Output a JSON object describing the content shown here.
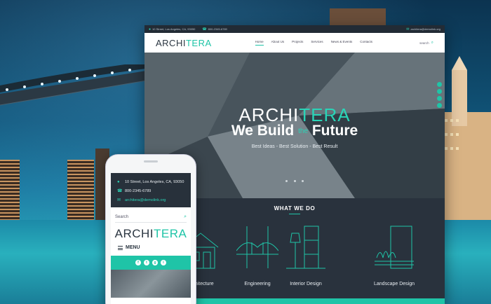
{
  "colors": {
    "accent": "#1fc4a7",
    "dark": "#29323d",
    "white": "#ffffff"
  },
  "desktop": {
    "topbar": {
      "address": "10 Street, Los Angeles, CA, 93050",
      "phone": "800-2345-6789",
      "email": "architera@demolink.org"
    },
    "logo": {
      "part1": "ARCHI",
      "part2": "TERA"
    },
    "menu": [
      "Home",
      "About Us",
      "Projects",
      "Services",
      "News & Events",
      "Contacts"
    ],
    "search_label": "search",
    "hero": {
      "logo_part1": "ARCHI",
      "logo_part2": "TERA",
      "title_before": "We Build",
      "title_the": "the",
      "title_after": "Future",
      "subtitle": "Best Ideas - Best Solution - Best Result"
    },
    "what_we_do": {
      "title": "WHAT WE DO",
      "services": [
        {
          "label": "Architecture",
          "icon": "house-icon"
        },
        {
          "label": "Engineering",
          "icon": "bridge-icon"
        },
        {
          "label": "Interior Design",
          "icon": "lamp-icon"
        },
        {
          "label": "Landscape Design",
          "icon": "plants-icon"
        }
      ]
    }
  },
  "phone": {
    "address": "10 Street, Los Angeles, CA, 93050",
    "phone": "800-2345-6789",
    "email": "architera@demolink.org",
    "search_placeholder": "Search",
    "logo_part1": "ARCHI",
    "logo_part2": "TERA",
    "menu_label": "MENU",
    "social": [
      "f",
      "t",
      "g",
      "i"
    ]
  }
}
